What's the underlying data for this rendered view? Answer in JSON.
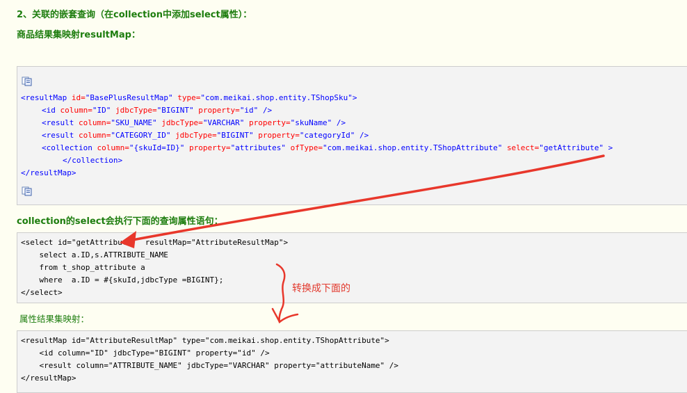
{
  "heading_section": "2、关联的嵌套查询（在collection中添加select属性）：",
  "heading_goods": "商品结果集映射resultMap：",
  "block1": {
    "open_tag": "<resultMap",
    "open_id_attr": "id=",
    "open_id_val": "\"BasePlusResultMap\"",
    "open_type_attr": "type=",
    "open_type_val": "\"com.meikai.shop.entity.TShopSku\"",
    "open_close": ">",
    "l2_tag": "<id",
    "l2_a1": "column=",
    "l2_v1": "\"ID\"",
    "l2_a2": "jdbcType=",
    "l2_v2": "\"BIGINT\"",
    "l2_a3": "property=",
    "l2_v3": "\"id\"",
    "l2_end": "/>",
    "l3_tag": "<result",
    "l3_a1": "column=",
    "l3_v1": "\"SKU_NAME\"",
    "l3_a2": "jdbcType=",
    "l3_v2": "\"VARCHAR\"",
    "l3_a3": "property=",
    "l3_v3": "\"skuName\"",
    "l3_end": "/>",
    "l4_tag": "<result",
    "l4_a1": "column=",
    "l4_v1": "\"CATEGORY_ID\"",
    "l4_a2": "jdbcType=",
    "l4_v2": "\"BIGINT\"",
    "l4_a3": "property=",
    "l4_v3": "\"categoryId\"",
    "l4_end": "/>",
    "l5_tag": "<collection",
    "l5_a1": "column=",
    "l5_v1": "\"{skuId=ID}\"",
    "l5_a2": "property=",
    "l5_v2": "\"attributes\"",
    "l5_a3": "ofType=",
    "l5_v3": "\"com.meikai.shop.entity.TShopAttribute\"",
    "l5_a4": "select=",
    "l5_v4": "\"getAttribute\"",
    "l5_end": ">",
    "l6": "</collection>",
    "l7": "</resultMap>"
  },
  "heading_collection": "collection的select会执行下面的查询属性语句：",
  "block2": {
    "lines": [
      "<select id=\"getAttribute\"  resultMap=\"AttributeResultMap\">",
      "    select a.ID,s.ATTRIBUTE_NAME",
      "    from t_shop_attribute a",
      "    where  a.ID = #{skuId,jdbcType =BIGINT};",
      "</select>"
    ]
  },
  "annotation": "转换成下面的",
  "heading_attr": "属性结果集映射：",
  "block3": {
    "lines": [
      "<resultMap id=\"AttributeResultMap\" type=\"com.meikai.shop.entity.TShopAttribute\">",
      "    <id column=\"ID\" jdbcType=\"BIGINT\" property=\"id\" />",
      "    <result column=\"ATTRIBUTE_NAME\" jdbcType=\"VARCHAR\" property=\"attributeName\" />",
      "</resultMap>"
    ]
  },
  "colors": {
    "heading": "#1d7d0e",
    "tag": "#0000ff",
    "attribute": "#ff0000",
    "annotation": "#e23a2e",
    "code_bg": "#f3f3f3"
  },
  "icons": [
    "copy-code-icon"
  ]
}
